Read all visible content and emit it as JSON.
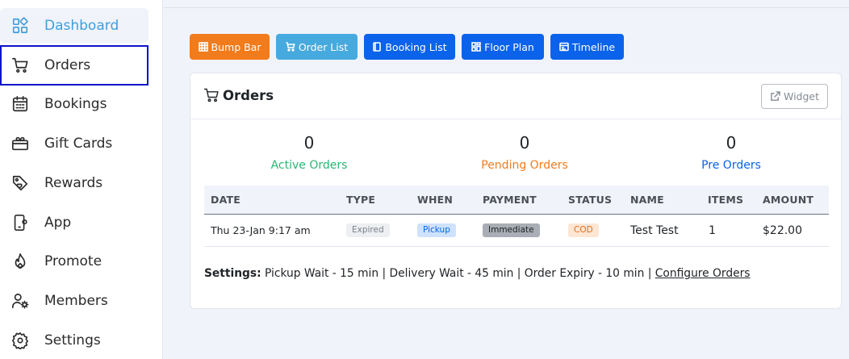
{
  "sidebar": {
    "items": [
      {
        "label": "Dashboard",
        "icon": "dashboard-icon"
      },
      {
        "label": "Orders",
        "icon": "cart-icon"
      },
      {
        "label": "Bookings",
        "icon": "calendar-icon"
      },
      {
        "label": "Gift Cards",
        "icon": "gift-icon"
      },
      {
        "label": "Rewards",
        "icon": "tag-icon"
      },
      {
        "label": "App",
        "icon": "phone-icon"
      },
      {
        "label": "Promote",
        "icon": "flame-icon"
      },
      {
        "label": "Members",
        "icon": "members-icon"
      },
      {
        "label": "Settings",
        "icon": "gear-icon"
      }
    ]
  },
  "toolbar": {
    "bump_bar": "Bump Bar",
    "order_list": "Order List",
    "booking_list": "Booking List",
    "floor_plan": "Floor Plan",
    "timeline": "Timeline"
  },
  "card": {
    "title": "Orders",
    "widget_label": "Widget"
  },
  "stats": {
    "active": {
      "value": "0",
      "label": "Active Orders"
    },
    "pending": {
      "value": "0",
      "label": "Pending Orders"
    },
    "pre": {
      "value": "0",
      "label": "Pre Orders"
    }
  },
  "table": {
    "columns": [
      "DATE",
      "TYPE",
      "WHEN",
      "PAYMENT",
      "STATUS",
      "NAME",
      "ITEMS",
      "AMOUNT"
    ],
    "rows": [
      {
        "date": "Thu 23-Jan 9:17 am",
        "type": "Expired",
        "when": "Pickup",
        "payment": "Immediate",
        "status": "COD",
        "name": "Test Test",
        "items": "1",
        "amount": "$22.00"
      }
    ]
  },
  "settings": {
    "label": "Settings:",
    "text": " Pickup Wait - 15 min | Delivery Wait - 45 min | Order Expiry - 10 min | ",
    "link": "Configure Orders"
  },
  "colors": {
    "accent": "#3f9fdc",
    "orange": "#f27b1b",
    "blue": "#0a63ea",
    "green": "#2bb673"
  }
}
